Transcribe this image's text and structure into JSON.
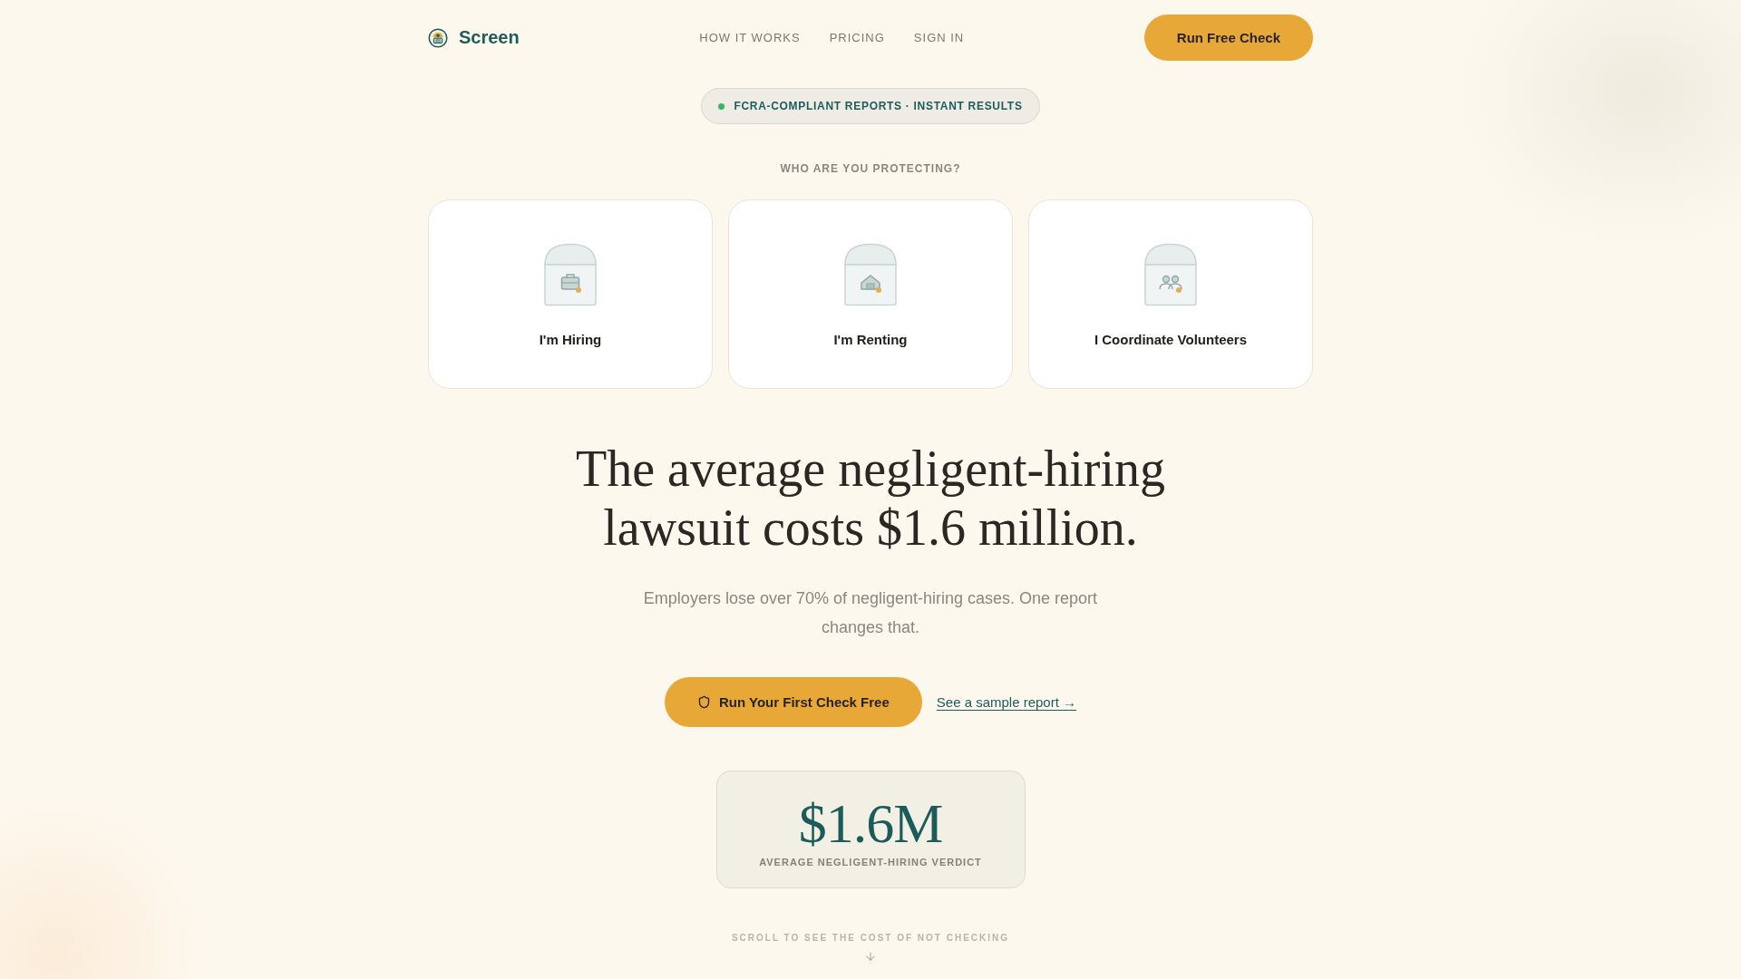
{
  "header": {
    "logo": "Screen",
    "nav": [
      "HOW IT WORKS",
      "PRICING",
      "SIGN IN"
    ],
    "cta": "Run Free Check"
  },
  "badge": {
    "text": "FCRA-COMPLIANT REPORTS · INSTANT RESULTS"
  },
  "audience": {
    "heading": "WHO ARE YOU PROTECTING?",
    "cards": [
      {
        "label": "I'm Hiring"
      },
      {
        "label": "I'm Renting"
      },
      {
        "label": "I Coordinate Volunteers"
      }
    ]
  },
  "hero": {
    "headline": "The average negligent-hiring lawsuit costs $1.6 million.",
    "subtitle": "Employers lose over 70% of negligent-hiring cases. One report changes that.",
    "primary_button": "Run Your First Check Free",
    "link": "See a sample report →"
  },
  "stat": {
    "value": "$1.6M",
    "label": "AVERAGE NEGLIGENT-HIRING VERDICT"
  },
  "scroll_hint": "SCROLL TO SEE THE COST OF NOT CHECKING"
}
